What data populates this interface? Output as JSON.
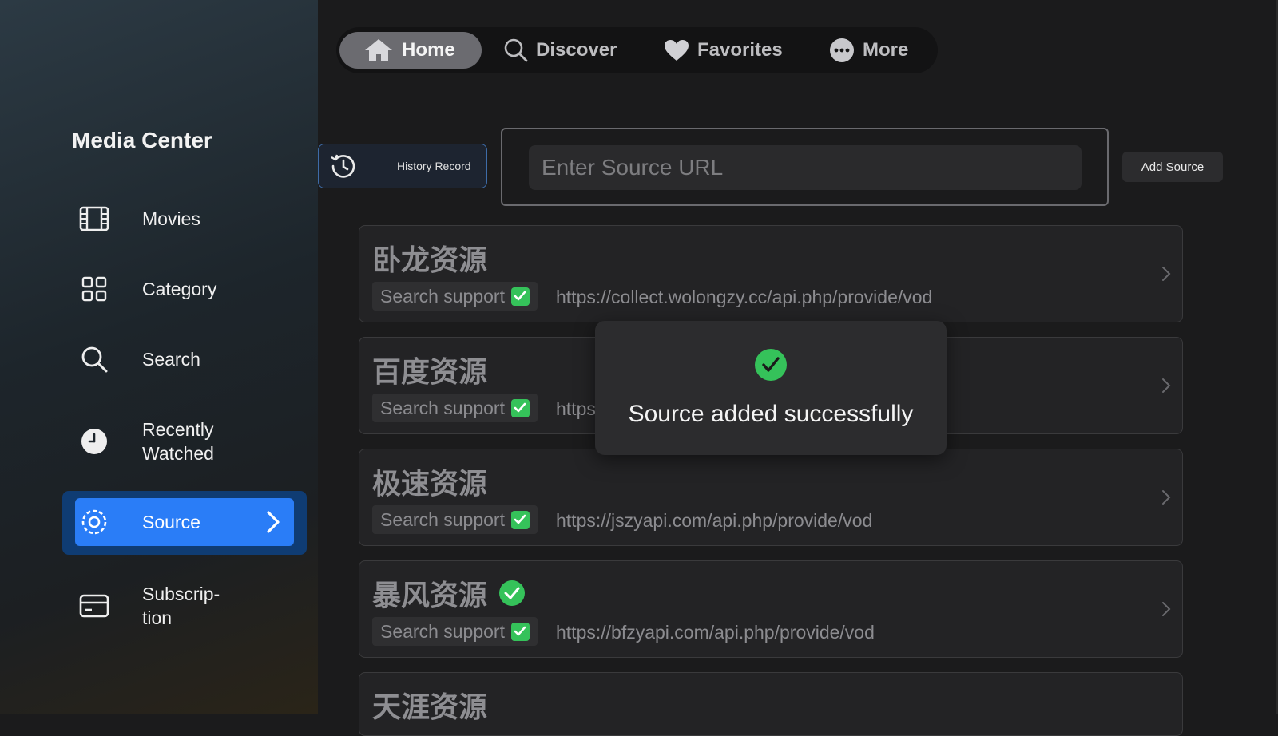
{
  "sidebar": {
    "title": "Media Center",
    "items": [
      {
        "label": "Movies",
        "icon": "film-icon"
      },
      {
        "label": "Category",
        "icon": "grid-icon"
      },
      {
        "label": "Search",
        "icon": "search-icon"
      },
      {
        "label": "Recently Watched",
        "icon": "clock-icon"
      },
      {
        "label": "Source",
        "icon": "gear-icon",
        "selected": true
      },
      {
        "label": "Subscrip- tion",
        "icon": "card-icon"
      }
    ]
  },
  "topnav": {
    "tabs": [
      {
        "label": "Home",
        "icon": "home-icon",
        "active": true
      },
      {
        "label": "Discover",
        "icon": "search-icon"
      },
      {
        "label": "Favorites",
        "icon": "heart-icon"
      },
      {
        "label": "More",
        "icon": "more-icon"
      }
    ]
  },
  "toolbar": {
    "history_label": "History Record",
    "url_placeholder": "Enter Source URL",
    "add_label": "Add Source"
  },
  "sources": [
    {
      "name": "卧龙资源",
      "support": "Search support",
      "url": "https://collect.wolongzy.cc/api.php/provide/vod"
    },
    {
      "name": "百度资源",
      "support": "Search support",
      "url": "https"
    },
    {
      "name": "极速资源",
      "support": "Search support",
      "url": "https://jszyapi.com/api.php/provide/vod"
    },
    {
      "name": "暴风资源",
      "support": "Search support",
      "url": "https://bfzyapi.com/api.php/provide/vod",
      "verified": true
    },
    {
      "name": "天涯资源"
    }
  ],
  "toast": {
    "message": "Source added successfully"
  },
  "colors": {
    "accent": "#2a7df7",
    "selected_bg": "#0f3c73",
    "success": "#35c25a"
  }
}
